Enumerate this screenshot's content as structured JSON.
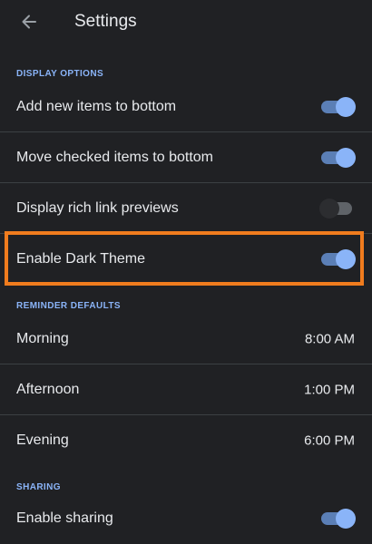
{
  "header": {
    "back_icon": "arrow-back-icon",
    "title": "Settings"
  },
  "sections": {
    "display": {
      "label": "DISPLAY OPTIONS"
    },
    "reminders": {
      "label": "REMINDER DEFAULTS"
    },
    "sharing": {
      "label": "SHARING"
    }
  },
  "display_options": [
    {
      "label": "Add new items to bottom",
      "enabled": true
    },
    {
      "label": "Move checked items to bottom",
      "enabled": true
    },
    {
      "label": "Display rich link previews",
      "enabled": false
    },
    {
      "label": "Enable Dark Theme",
      "enabled": true,
      "highlighted": true
    }
  ],
  "reminder_defaults": [
    {
      "label": "Morning",
      "value": "8:00 AM"
    },
    {
      "label": "Afternoon",
      "value": "1:00 PM"
    },
    {
      "label": "Evening",
      "value": "6:00 PM"
    }
  ],
  "sharing": [
    {
      "label": "Enable sharing",
      "enabled": true
    }
  ],
  "colors": {
    "background": "#202124",
    "accent": "#8ab4f8",
    "highlight_border": "#f07c1e"
  }
}
